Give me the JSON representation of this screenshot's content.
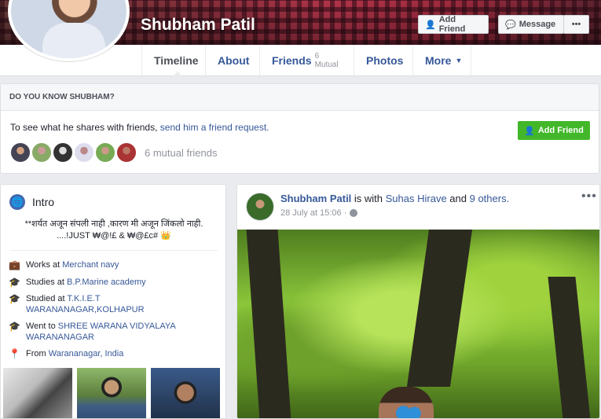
{
  "header": {
    "name": "Shubham Patil",
    "add_friend": "Add Friend",
    "message": "Message",
    "more": "•••"
  },
  "tabs": {
    "timeline": "Timeline",
    "about": "About",
    "friends": "Friends",
    "friends_count": "6 Mutual",
    "photos": "Photos",
    "more": "More"
  },
  "know": {
    "heading": "DO YOU KNOW SHUBHAM?",
    "text": "To see what he shares with friends, ",
    "link": "send him a friend request.",
    "button": "Add Friend",
    "mutual": "6 mutual friends"
  },
  "intro": {
    "heading": "Intro",
    "bio_line1": "**शर्यत अजून संपली नाही ,कारण मी अजून जिंकलो नाही.",
    "bio_line2": "....!JUST ₩@!£ & ₩@£c# 👑",
    "works_prefix": "Works at ",
    "works": "Merchant navy",
    "studies_prefix": "Studies at ",
    "studies": "B.P.Marine academy",
    "studied_prefix": "Studied at ",
    "studied": "T.K.I.E.T WARANANAGAR,KOLHAPUR",
    "went_prefix": "Went to ",
    "went": "SHREE WARANA VIDYALAYA WARANANAGAR",
    "from_prefix": "From ",
    "from": "Warananagar, India"
  },
  "post": {
    "author": "Shubham Patil",
    "with_text": " is with ",
    "tagged": "Suhas Hirave",
    "and_text": " and ",
    "others": "9 others.",
    "date": "28 July at 15:06 ·",
    "more": "•••"
  },
  "colors": {
    "link": "#365899",
    "green": "#42b72a",
    "globe": "#4267b2"
  }
}
